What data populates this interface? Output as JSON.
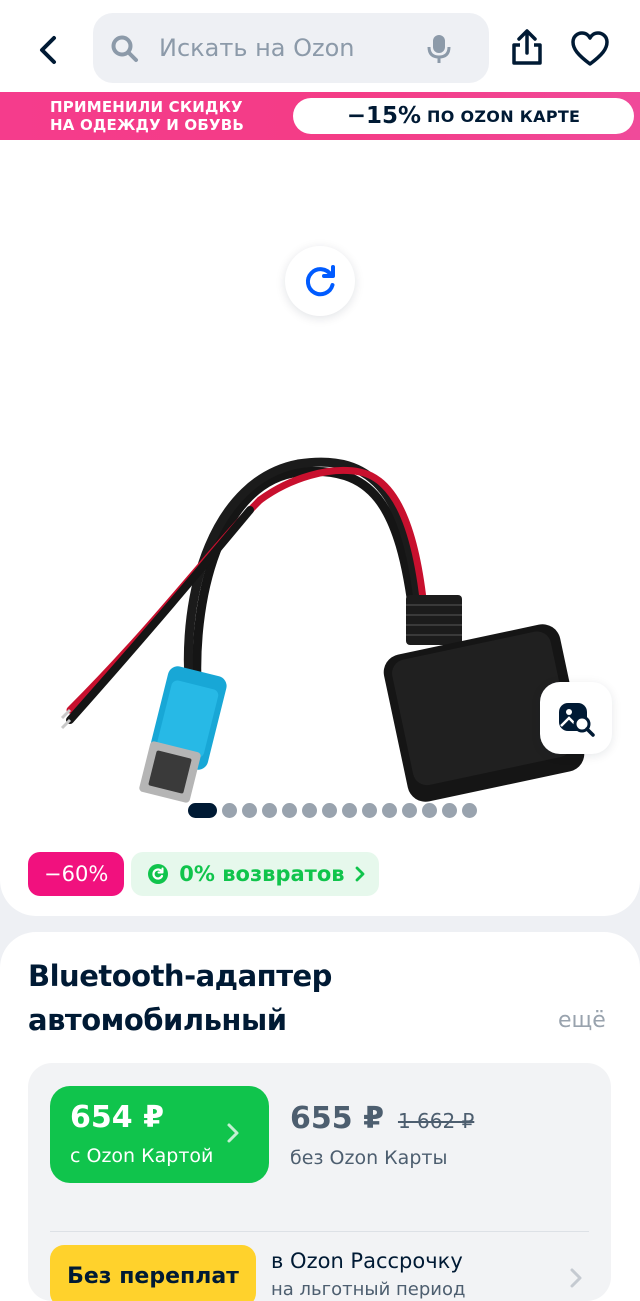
{
  "header": {
    "search_placeholder": "Искать на Ozon",
    "icons": [
      "back-arrow-icon",
      "search-icon",
      "microphone-icon",
      "share-icon",
      "heart-icon"
    ]
  },
  "promo": {
    "left_line1": "ПРИМЕНИЛИ СКИДКУ",
    "left_line2": "НА ОДЕЖДУ И ОБУВЬ",
    "discount": "−15%",
    "right_text": "ПО OZON КАРТЕ"
  },
  "gallery": {
    "image_count": 14,
    "active_index": 0,
    "discount_badge": "−60%",
    "returns_badge": "0% возвратов"
  },
  "product": {
    "title_line1": "Bluetooth-адаптер",
    "title_line2": "автомобильный",
    "more_link": "ещё"
  },
  "price": {
    "card_price": "654 ₽",
    "card_caption": "с Ozon Картой",
    "regular_price": "655 ₽",
    "old_price": "1 662 ₽",
    "regular_caption": "без Ozon Карты"
  },
  "installment": {
    "pill_label": "Без переплат",
    "line1": "в Ozon Рассрочку",
    "line2": "на льготный период"
  },
  "colors": {
    "promo_pink": "#f43c86",
    "discount_pink": "#f1117e",
    "green": "#10c44c",
    "yellow": "#ffd22c",
    "navy": "#001a34"
  }
}
